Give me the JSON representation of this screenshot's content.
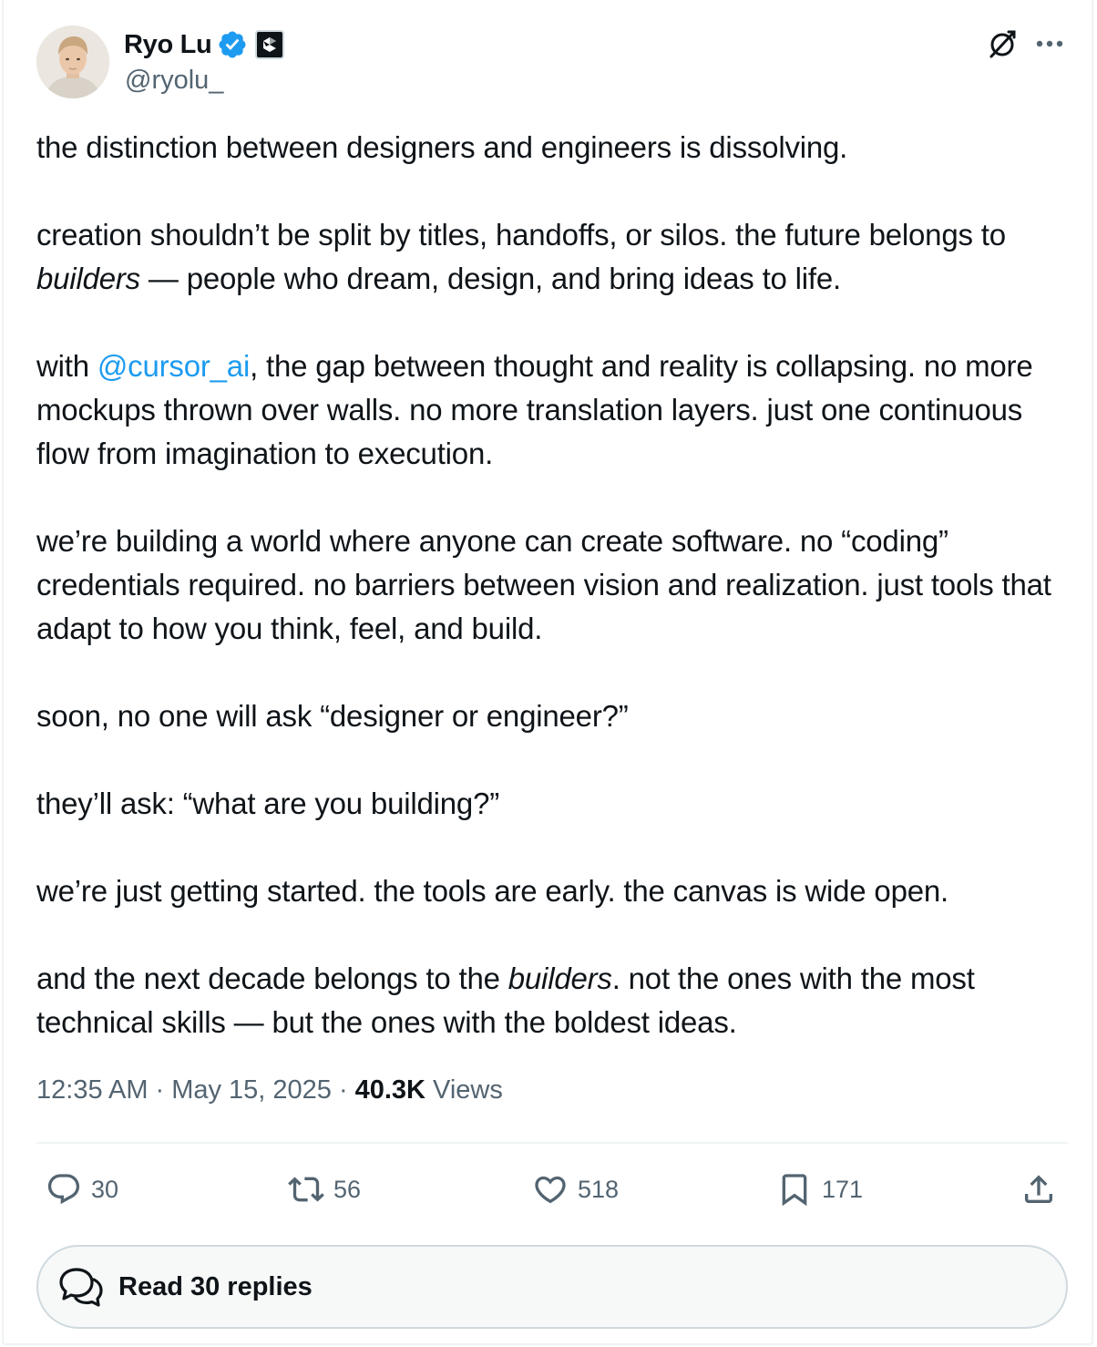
{
  "author": {
    "name": "Ryo Lu",
    "handle": "@ryolu_",
    "avatar_icon": "person-avatar",
    "verified_icon": "verified-badge-icon",
    "verified_color": "#1d9bf0",
    "affiliate_icon": "affiliate-badge-icon"
  },
  "header_icons": [
    "grok-icon",
    "more-icon"
  ],
  "tweet": {
    "paragraphs": {
      "p1": "the distinction between designers and engineers is dissolving.",
      "p2_a": "creation shouldn’t be split by titles, handoffs, or silos. the future belongs to ",
      "p2_em": "builders",
      "p2_b": " — people who dream, design, and bring ideas to life.",
      "p3_a": "with ",
      "p3_mention": "@cursor_ai",
      "p3_b": ", the gap between thought and reality is collapsing. no more mockups thrown over walls. no more translation layers. just one continuous flow from imagination to execution.",
      "p4": "we’re building a world where anyone can create software. no “coding” credentials required. no barriers between vision and realization. just tools that adapt to how you think, feel, and build.",
      "p5": "soon, no one will ask “designer or engineer?”",
      "p6": "they’ll ask: “what are you building?”",
      "p7": "we’re just getting started. the tools are early. the canvas is wide open.",
      "p8_a": "and the next decade belongs to the ",
      "p8_em": "builders",
      "p8_b": ". not the ones with the most technical skills — but the ones with the boldest ideas."
    },
    "mention_color": "#1d9bf0"
  },
  "meta": {
    "time": "12:35 AM",
    "separator": "·",
    "date": "May 15, 2025",
    "views_count": "40.3K",
    "views_label": "Views"
  },
  "actions": {
    "replies": "30",
    "retweets": "56",
    "likes": "518",
    "bookmarks": "171",
    "icons": [
      "reply-icon",
      "retweet-icon",
      "like-icon",
      "bookmark-icon",
      "share-icon"
    ]
  },
  "read_replies": {
    "label": "Read 30 replies",
    "icon": "conversation-icon"
  }
}
